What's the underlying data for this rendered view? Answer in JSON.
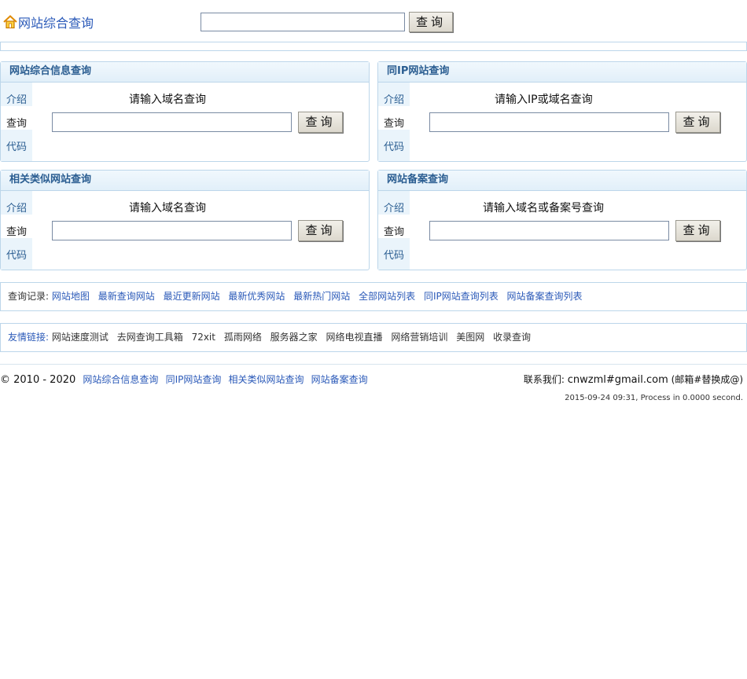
{
  "header": {
    "logo_text": "网站综合查询",
    "search_value": "",
    "search_button": "查询"
  },
  "panels": [
    {
      "title": "网站综合信息查询",
      "side": [
        "介绍",
        "查询",
        "代码"
      ],
      "prompt": "请输入域名查询",
      "input_value": "",
      "button": "查询"
    },
    {
      "title": "同IP网站查询",
      "side": [
        "介绍",
        "查询",
        "代码"
      ],
      "prompt": "请输入IP或域名查询",
      "input_value": "",
      "button": "查询"
    },
    {
      "title": "相关类似网站查询",
      "side": [
        "介绍",
        "查询",
        "代码"
      ],
      "prompt": "请输入域名查询",
      "input_value": "",
      "button": "查询"
    },
    {
      "title": "网站备案查询",
      "side": [
        "介绍",
        "查询",
        "代码"
      ],
      "prompt": "请输入域名或备案号查询",
      "input_value": "",
      "button": "查询"
    }
  ],
  "query_records": {
    "label": "查询记录:",
    "items": [
      "网站地图",
      "最新查询网站",
      "最近更新网站",
      "最新优秀网站",
      "最新热门网站",
      "全部网站列表",
      "同IP网站查询列表",
      "网站备案查询列表"
    ]
  },
  "friend_links": {
    "label": "友情链接:",
    "items": [
      "网站速度测试",
      "去网查询工具箱",
      "72xit",
      "孤雨网络",
      "服务器之家",
      "网络电视直播",
      "网络营销培训",
      "美图网",
      "收录查询"
    ]
  },
  "footer": {
    "copyright": "© 2010 - 2020",
    "links": [
      "网站综合信息查询",
      "同IP网站查询",
      "相关类似网站查询",
      "网站备案查询"
    ],
    "contact_label": "联系我们:",
    "contact_email": "cnwzml#gmail.com",
    "contact_note": "(邮箱#替换成@)",
    "status": "2015-09-24 09:31, Process in 0.0000 second."
  },
  "colors": {
    "link": "#2a59b8",
    "panel_border": "#bcd6ea",
    "panel_title": "#2a5d91"
  }
}
